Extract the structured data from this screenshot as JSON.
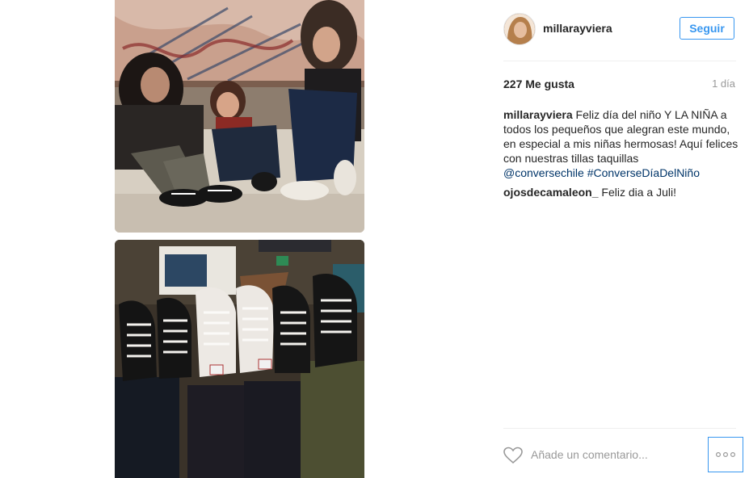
{
  "post": {
    "username": "millarayviera",
    "follow_label": "Seguir",
    "likes": "227 Me gusta",
    "time_ago": "1 día",
    "comments": [
      {
        "author": "millarayviera",
        "text": "Feliz día del niño Y LA NIÑA a todos los pequeños que alegran este mundo, en especial a mis niñas hermosas! Aquí felices con nuestras tillas taquillas",
        "tags": [
          "@conversechile",
          "#ConverseDíaDelNiño"
        ]
      },
      {
        "author": "ojosdecamaleon_",
        "text": "Feliz dia a Juli!",
        "tags": []
      }
    ],
    "add_comment_placeholder": "Añade un comentario...",
    "more_label": "...",
    "heart_icon": "heart-outline-icon",
    "more_icon": "ellipsis-icon"
  },
  "colors": {
    "accent": "#3897f0",
    "tag": "#003569",
    "muted": "#999999"
  }
}
